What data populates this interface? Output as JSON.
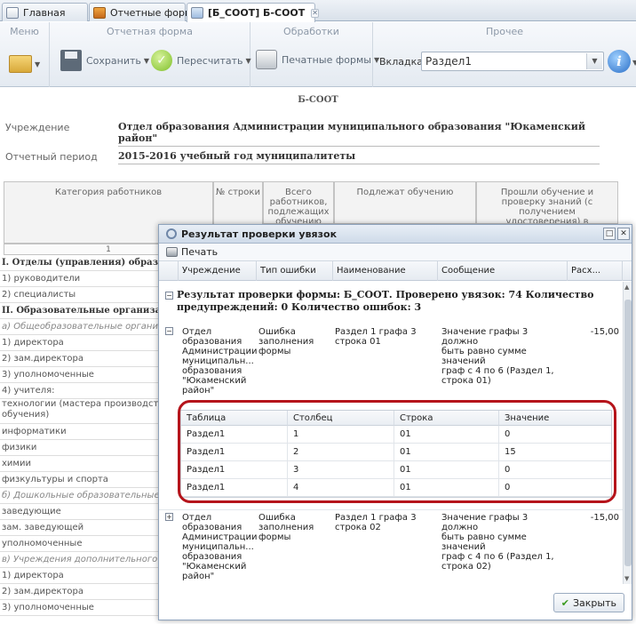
{
  "tabs": [
    {
      "label": "Главная"
    },
    {
      "label": "Отчетные формы"
    },
    {
      "label": "[Б_СООТ] Б-СООТ"
    }
  ],
  "toolbar": {
    "groups": [
      "Меню",
      "Отчетная форма",
      "Обработки",
      "Прочее"
    ],
    "save": "Сохранить",
    "recalc": "Пересчитать",
    "print_forms": "Печатные формы",
    "tab_label": "Вкладка",
    "tab_value": "Раздел1"
  },
  "form": {
    "title": "Б-СООТ",
    "institution_label": "Учреждение",
    "institution_value": "Отдел образования Администрации муниципального образования \"Юкаменский район\"",
    "period_label": "Отчетный период",
    "period_value": "2015-2016 учебный год муниципалитеты",
    "col_headers": [
      "Категория работников",
      "№ строки",
      "Всего работников, подлежащих обучению",
      "Подлежат обучению",
      "Прошли обучение и проверку знаний (с получением удостоверения) в текущем"
    ],
    "row_number_header": "1",
    "rows": [
      {
        "text": "I. Отделы (управления) образова",
        "style": "bold"
      },
      {
        "text": "1) руководители",
        "style": ""
      },
      {
        "text": "2) специалисты",
        "style": ""
      },
      {
        "text": "II. Образовательные организац",
        "style": "bold"
      },
      {
        "text": "а) Общеобразовательные организа",
        "style": "ital"
      },
      {
        "text": "1) директора",
        "style": ""
      },
      {
        "text": "2) зам.директора",
        "style": ""
      },
      {
        "text": "3) уполномоченные",
        "style": ""
      },
      {
        "text": "4) учителя:",
        "style": ""
      },
      {
        "text": "технологии (мастера производстве обучения)",
        "style": "two"
      },
      {
        "text": "информатики",
        "style": ""
      },
      {
        "text": "физики",
        "style": ""
      },
      {
        "text": "химии",
        "style": ""
      },
      {
        "text": "физкультуры и спорта",
        "style": ""
      },
      {
        "text": "б) Дошкольные образовательные с",
        "style": "ital"
      },
      {
        "text": "заведующие",
        "style": ""
      },
      {
        "text": "зам. заведующей",
        "style": ""
      },
      {
        "text": "уполномоченные",
        "style": ""
      },
      {
        "text": "в) Учреждения дополнительного о",
        "style": "ital"
      },
      {
        "text": "1) директора",
        "style": ""
      },
      {
        "text": "2) зам.директора",
        "style": ""
      },
      {
        "text": "3) уполномоченные",
        "style": ""
      }
    ]
  },
  "dialog": {
    "title": "Результат проверки увязок",
    "print": "Печать",
    "columns": [
      "Учреждение",
      "Тип ошибки",
      "Наименование",
      "Сообщение",
      "Расх..."
    ],
    "summary": "Результат проверки формы: Б_СООТ. Проверено увязок: 74 Количество предупреждений: 0 Количество ошибок: 3",
    "errors": [
      {
        "institution": [
          "Отдел",
          "образования",
          "Администрации",
          "муниципальн...",
          "образования",
          "\"Юкаменский",
          "район\""
        ],
        "type": [
          "Ошибка",
          "заполнения",
          "формы"
        ],
        "name": [
          "Раздел 1 графа 3",
          "строка 01"
        ],
        "message": [
          "Значение графы 3 должно",
          "быть равно сумме значений",
          "граф с 4 по 6 (Раздел 1,",
          "строка 01)"
        ],
        "diff": "-15,00"
      },
      {
        "institution": [
          "Отдел",
          "образования",
          "Администрации",
          "муниципальн...",
          "образования",
          "\"Юкаменский",
          "район\""
        ],
        "type": [
          "Ошибка",
          "заполнения",
          "формы"
        ],
        "name": [
          "Раздел 1 графа 3",
          "строка 02"
        ],
        "message": [
          "Значение графы 3 должно",
          "быть равно сумме значений",
          "граф с 4 по 6 (Раздел 1,",
          "строка 02)"
        ],
        "diff": "-15,00"
      }
    ],
    "inner_columns": [
      "Таблица",
      "Столбец",
      "Строка",
      "Значение"
    ],
    "inner_rows": [
      [
        "Раздел1",
        "1",
        "01",
        "0"
      ],
      [
        "Раздел1",
        "2",
        "01",
        "15"
      ],
      [
        "Раздел1",
        "3",
        "01",
        "0"
      ],
      [
        "Раздел1",
        "4",
        "01",
        "0"
      ]
    ],
    "close": "Закрыть"
  },
  "colors": {
    "accent": "#b5141b",
    "header_bg": "#d9e1ea"
  }
}
